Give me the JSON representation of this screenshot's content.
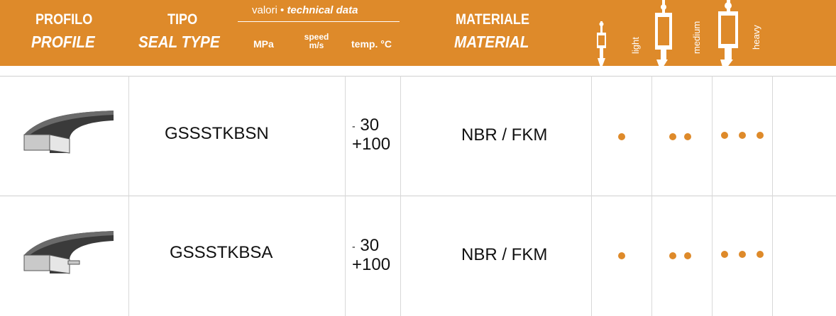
{
  "header": {
    "profile_it": "PROFILO",
    "profile_en": "PROFILE",
    "type_it": "TIPO",
    "type_en": "SEAL TYPE",
    "values_it": "valori •",
    "values_en": "technical data",
    "mpa": "MPa",
    "speed_1": "speed",
    "speed_2": "m/s",
    "temp": "temp. °C",
    "material_it": "MATERIALE",
    "material_en": "MATERIAL",
    "light": "light",
    "medium": "medium",
    "heavy": "heavy"
  },
  "rows": [
    {
      "code": "GSSSTKBSN",
      "temp_min": "30",
      "temp_min_sign": "-",
      "temp_max": "+100",
      "material_a": "NBR",
      "material_b": "/ FKM",
      "light_dots": 1,
      "medium_dots": 2,
      "heavy_dots": 3
    },
    {
      "code": "GSSSTKBSA",
      "temp_min": "30",
      "temp_min_sign": "-",
      "temp_max": "+100",
      "material_a": "NBR",
      "material_b": "/ FKM",
      "light_dots": 1,
      "medium_dots": 2,
      "heavy_dots": 3
    }
  ],
  "colors": {
    "accent": "#de8a2a",
    "text": "#111111"
  }
}
